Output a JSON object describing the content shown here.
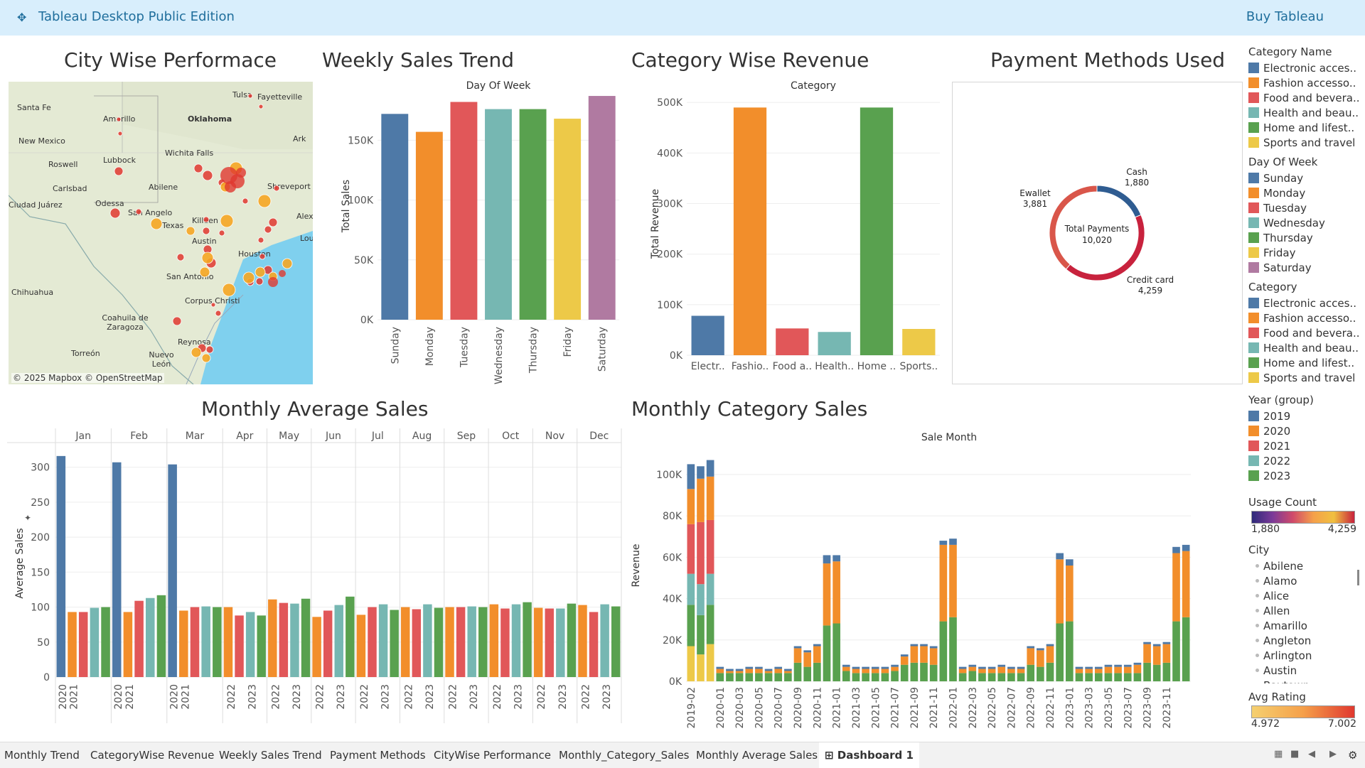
{
  "app": {
    "logo_icon": "tableau-logo-icon",
    "title": "Tableau Desktop Public Edition",
    "buy_label": "Buy Tableau"
  },
  "titles": {
    "city": "City Wise Performace",
    "weekly": "Weekly Sales Trend",
    "category": "Category Wise Revenue",
    "payment": "Payment Methods Used",
    "monthly_avg": "Monthly Average Sales",
    "monthly_cat": "Monthly Category Sales"
  },
  "map": {
    "copyright": "© 2025 Mapbox © OpenStreetMap",
    "labels": [
      "Santa Fe",
      "Tulsa",
      "Fayetteville",
      "Amarillo",
      "Oklahoma",
      "New Mexico",
      "Lubbock",
      "Wichita Falls",
      "Ark",
      "Roswell",
      "Abilene",
      "Shreveport",
      "Carlsbad",
      "Odessa",
      "San Angelo",
      "Killeen",
      "Alex",
      "Texas",
      "Ciudad Juárez",
      "Austin",
      "Lou",
      "Houston",
      "San Antonio",
      "Chihuahua",
      "Corpus Christi",
      "Coahuila de Zaragoza",
      "Torreón",
      "Nuevo León",
      "Reynosa"
    ]
  },
  "chart_data": [
    {
      "id": "weekly",
      "type": "bar",
      "title": "Day Of Week",
      "ylabel": "Total Sales",
      "ylim": [
        0,
        190000
      ],
      "yticks": [
        "0K",
        "50K",
        "100K",
        "150K"
      ],
      "categories": [
        "Sunday",
        "Monday",
        "Tuesday",
        "Wednesday",
        "Thursday",
        "Friday",
        "Saturday"
      ],
      "values": [
        172000,
        157000,
        182000,
        176000,
        176000,
        168000,
        187000
      ],
      "colors": [
        "#4e79a7",
        "#f28e2b",
        "#e15759",
        "#76b7b2",
        "#59a14f",
        "#edc948",
        "#b07aa1"
      ]
    },
    {
      "id": "category",
      "type": "bar",
      "title": "Category",
      "ylabel": "Total Revenue",
      "ylim": [
        0,
        520000
      ],
      "yticks": [
        "0K",
        "100K",
        "200K",
        "300K",
        "400K",
        "500K"
      ],
      "categories": [
        "Electr..",
        "Fashio..",
        "Food a..",
        "Health..",
        "Home ..",
        "Sports.."
      ],
      "values": [
        78000,
        490000,
        53000,
        46000,
        490000,
        52000
      ],
      "colors": [
        "#4e79a7",
        "#f28e2b",
        "#e15759",
        "#76b7b2",
        "#59a14f",
        "#edc948"
      ]
    },
    {
      "id": "payment",
      "type": "pie",
      "center_label": "Total Payments",
      "total": "10,020",
      "slices": [
        {
          "name": "Cash",
          "value": 1880,
          "label": "1,880",
          "color": "#2f5c91"
        },
        {
          "name": "Credit card",
          "value": 4259,
          "label": "4,259",
          "color": "#c8223d"
        },
        {
          "name": "Ewallet",
          "value": 3881,
          "label": "3,881",
          "color": "#d9564a"
        }
      ]
    },
    {
      "id": "monthly_avg",
      "type": "bar",
      "ylabel": "Average Sales",
      "ylim": [
        0,
        325
      ],
      "yticks": [
        "0",
        "50",
        "100",
        "150",
        "200",
        "250",
        "300"
      ],
      "months": [
        {
          "name": "Jan",
          "bars": [
            {
              "year": "2019",
              "value": 316
            },
            {
              "year": "2020",
              "value": 93
            },
            {
              "year": "2021",
              "value": 93
            },
            {
              "year": "2022",
              "value": 99
            },
            {
              "year": "2023",
              "value": 100
            }
          ],
          "xlabels": [
            "2020",
            "2021"
          ]
        },
        {
          "name": "Feb",
          "bars": [
            {
              "year": "2019",
              "value": 307
            },
            {
              "year": "2020",
              "value": 93
            },
            {
              "year": "2021",
              "value": 109
            },
            {
              "year": "2022",
              "value": 113
            },
            {
              "year": "2023",
              "value": 117
            }
          ],
          "xlabels": [
            "2020",
            "2021"
          ]
        },
        {
          "name": "Mar",
          "bars": [
            {
              "year": "2019",
              "value": 304
            },
            {
              "year": "2020",
              "value": 95
            },
            {
              "year": "2021",
              "value": 100
            },
            {
              "year": "2022",
              "value": 101
            },
            {
              "year": "2023",
              "value": 100
            }
          ],
          "xlabels": [
            "2020",
            "2021"
          ]
        },
        {
          "name": "Apr",
          "bars": [
            {
              "year": "2020",
              "value": 100
            },
            {
              "year": "2021",
              "value": 88
            },
            {
              "year": "2022",
              "value": 93
            },
            {
              "year": "2023",
              "value": 88
            }
          ],
          "xlabels": [
            "2022",
            "2023"
          ]
        },
        {
          "name": "May",
          "bars": [
            {
              "year": "2020",
              "value": 111
            },
            {
              "year": "2021",
              "value": 106
            },
            {
              "year": "2022",
              "value": 105
            },
            {
              "year": "2023",
              "value": 112
            }
          ],
          "xlabels": [
            "2022",
            "2023"
          ]
        },
        {
          "name": "Jun",
          "bars": [
            {
              "year": "2020",
              "value": 86
            },
            {
              "year": "2021",
              "value": 95
            },
            {
              "year": "2022",
              "value": 103
            },
            {
              "year": "2023",
              "value": 115
            }
          ],
          "xlabels": [
            "2022",
            "2023"
          ]
        },
        {
          "name": "Jul",
          "bars": [
            {
              "year": "2020",
              "value": 89
            },
            {
              "year": "2021",
              "value": 100
            },
            {
              "year": "2022",
              "value": 104
            },
            {
              "year": "2023",
              "value": 96
            }
          ],
          "xlabels": [
            "2022",
            "2023"
          ]
        },
        {
          "name": "Aug",
          "bars": [
            {
              "year": "2020",
              "value": 100
            },
            {
              "year": "2021",
              "value": 97
            },
            {
              "year": "2022",
              "value": 104
            },
            {
              "year": "2023",
              "value": 99
            }
          ],
          "xlabels": [
            "2022",
            "2023"
          ]
        },
        {
          "name": "Sep",
          "bars": [
            {
              "year": "2020",
              "value": 100
            },
            {
              "year": "2021",
              "value": 100
            },
            {
              "year": "2022",
              "value": 101
            },
            {
              "year": "2023",
              "value": 100
            }
          ],
          "xlabels": [
            "2022",
            "2023"
          ]
        },
        {
          "name": "Oct",
          "bars": [
            {
              "year": "2020",
              "value": 104
            },
            {
              "year": "2021",
              "value": 98
            },
            {
              "year": "2022",
              "value": 104
            },
            {
              "year": "2023",
              "value": 107
            }
          ],
          "xlabels": [
            "2022",
            "2023"
          ]
        },
        {
          "name": "Nov",
          "bars": [
            {
              "year": "2020",
              "value": 99
            },
            {
              "year": "2021",
              "value": 98
            },
            {
              "year": "2022",
              "value": 98
            },
            {
              "year": "2023",
              "value": 105
            }
          ],
          "xlabels": [
            "2022",
            "2023"
          ]
        },
        {
          "name": "Dec",
          "bars": [
            {
              "year": "2020",
              "value": 103
            },
            {
              "year": "2021",
              "value": 93
            },
            {
              "year": "2022",
              "value": 104
            },
            {
              "year": "2023",
              "value": 101
            }
          ],
          "xlabels": [
            "2022",
            "2023"
          ]
        }
      ]
    },
    {
      "id": "monthly_cat",
      "type": "bar",
      "title": "Sale Month",
      "ylabel": "Revenue",
      "ylim": [
        0,
        112000
      ],
      "yticks": [
        "0K",
        "20K",
        "40K",
        "60K",
        "80K",
        "100K"
      ],
      "series_colors": [
        "#4e79a7",
        "#f28e2b",
        "#e15759",
        "#76b7b2",
        "#59a14f",
        "#edc948"
      ],
      "xtick_labels": [
        "2019-02",
        "2020-01",
        "2020-03",
        "2020-05",
        "2020-07",
        "2020-09",
        "2020-11",
        "2021-01",
        "2021-03",
        "2021-05",
        "2021-07",
        "2021-09",
        "2021-11",
        "2022-01",
        "2022-03",
        "2022-05",
        "2022-07",
        "2022-09",
        "2022-11",
        "2023-01",
        "2023-03",
        "2023-05",
        "2023-07",
        "2023-09",
        "2023-11"
      ],
      "bars": [
        [
          12000,
          17000,
          24000,
          15000,
          20000,
          17000
        ],
        [
          6000,
          21000,
          30000,
          15000,
          19000,
          13000
        ],
        [
          8000,
          21000,
          26000,
          15000,
          19000,
          18000
        ],
        [
          1000,
          2000,
          0,
          0,
          4000,
          0
        ],
        [
          1000,
          1000,
          0,
          0,
          4000,
          0
        ],
        [
          1000,
          1000,
          0,
          0,
          4000,
          0
        ],
        [
          1000,
          2000,
          0,
          0,
          4000,
          0
        ],
        [
          1000,
          2000,
          0,
          0,
          4000,
          0
        ],
        [
          1000,
          1000,
          0,
          0,
          4000,
          0
        ],
        [
          1000,
          2000,
          0,
          0,
          4000,
          0
        ],
        [
          1000,
          1000,
          0,
          0,
          4000,
          0
        ],
        [
          1000,
          7000,
          0,
          0,
          9000,
          0
        ],
        [
          1000,
          7000,
          0,
          0,
          7000,
          0
        ],
        [
          1000,
          8000,
          0,
          0,
          9000,
          0
        ],
        [
          4000,
          30000,
          0,
          0,
          27000,
          0
        ],
        [
          3000,
          30000,
          0,
          0,
          28000,
          0
        ],
        [
          1000,
          2000,
          0,
          0,
          5000,
          0
        ],
        [
          1000,
          2000,
          0,
          0,
          4000,
          0
        ],
        [
          1000,
          2000,
          0,
          0,
          4000,
          0
        ],
        [
          1000,
          2000,
          0,
          0,
          4000,
          0
        ],
        [
          1000,
          2000,
          0,
          0,
          4000,
          0
        ],
        [
          1000,
          2000,
          0,
          0,
          5000,
          0
        ],
        [
          1000,
          4000,
          0,
          0,
          8000,
          0
        ],
        [
          1000,
          8000,
          0,
          0,
          9000,
          0
        ],
        [
          1000,
          8000,
          0,
          0,
          9000,
          0
        ],
        [
          1000,
          8000,
          0,
          0,
          8000,
          0
        ],
        [
          2000,
          37000,
          0,
          0,
          29000,
          0
        ],
        [
          3000,
          35000,
          0,
          0,
          31000,
          0
        ],
        [
          1000,
          2000,
          0,
          0,
          4000,
          0
        ],
        [
          1000,
          2000,
          0,
          0,
          5000,
          0
        ],
        [
          1000,
          2000,
          0,
          0,
          4000,
          0
        ],
        [
          1000,
          2000,
          0,
          0,
          4000,
          0
        ],
        [
          1000,
          3000,
          0,
          0,
          4000,
          0
        ],
        [
          1000,
          2000,
          0,
          0,
          4000,
          0
        ],
        [
          1000,
          2000,
          0,
          0,
          4000,
          0
        ],
        [
          1000,
          8000,
          0,
          0,
          8000,
          0
        ],
        [
          1000,
          8000,
          0,
          0,
          7000,
          0
        ],
        [
          1000,
          8000,
          0,
          0,
          9000,
          0
        ],
        [
          3000,
          31000,
          0,
          0,
          28000,
          0
        ],
        [
          3000,
          27000,
          0,
          0,
          29000,
          0
        ],
        [
          1000,
          2000,
          0,
          0,
          4000,
          0
        ],
        [
          1000,
          2000,
          0,
          0,
          4000,
          0
        ],
        [
          1000,
          2000,
          0,
          0,
          4000,
          0
        ],
        [
          1000,
          3000,
          0,
          0,
          4000,
          0
        ],
        [
          1000,
          3000,
          0,
          0,
          4000,
          0
        ],
        [
          1000,
          3000,
          0,
          0,
          4000,
          0
        ],
        [
          1000,
          4000,
          0,
          0,
          4000,
          0
        ],
        [
          1000,
          9000,
          0,
          0,
          9000,
          0
        ],
        [
          1000,
          9000,
          0,
          0,
          8000,
          0
        ],
        [
          1000,
          9000,
          0,
          0,
          9000,
          0
        ],
        [
          3000,
          33000,
          0,
          0,
          29000,
          0
        ],
        [
          3000,
          32000,
          0,
          0,
          31000,
          0
        ]
      ]
    }
  ],
  "legends": {
    "category_name": {
      "title": "Category Name",
      "items": [
        {
          "label": "Electronic acces..",
          "color": "#4e79a7"
        },
        {
          "label": "Fashion accesso..",
          "color": "#f28e2b"
        },
        {
          "label": "Food and bevera..",
          "color": "#e15759"
        },
        {
          "label": "Health and beau..",
          "color": "#76b7b2"
        },
        {
          "label": "Home and lifest..",
          "color": "#59a14f"
        },
        {
          "label": "Sports and travel",
          "color": "#edc948"
        }
      ]
    },
    "day_of_week": {
      "title": "Day Of Week",
      "items": [
        {
          "label": "Sunday",
          "color": "#4e79a7"
        },
        {
          "label": "Monday",
          "color": "#f28e2b"
        },
        {
          "label": "Tuesday",
          "color": "#e15759"
        },
        {
          "label": "Wednesday",
          "color": "#76b7b2"
        },
        {
          "label": "Thursday",
          "color": "#59a14f"
        },
        {
          "label": "Friday",
          "color": "#edc948"
        },
        {
          "label": "Saturday",
          "color": "#b07aa1"
        }
      ]
    },
    "category": {
      "title": "Category",
      "items": [
        {
          "label": "Electronic acces..",
          "color": "#4e79a7"
        },
        {
          "label": "Fashion accesso..",
          "color": "#f28e2b"
        },
        {
          "label": "Food and bevera..",
          "color": "#e15759"
        },
        {
          "label": "Health and beau..",
          "color": "#76b7b2"
        },
        {
          "label": "Home and lifest..",
          "color": "#59a14f"
        },
        {
          "label": "Sports and travel",
          "color": "#edc948"
        }
      ]
    },
    "year_group": {
      "title": "Year (group)",
      "items": [
        {
          "label": "2019",
          "color": "#4e79a7"
        },
        {
          "label": "2020",
          "color": "#f28e2b"
        },
        {
          "label": "2021",
          "color": "#e15759"
        },
        {
          "label": "2022",
          "color": "#76b7b2"
        },
        {
          "label": "2023",
          "color": "#59a14f"
        }
      ]
    },
    "usage_count": {
      "title": "Usage Count",
      "min": "1,880",
      "max": "4,259"
    },
    "city": {
      "title": "City",
      "items": [
        "Abilene",
        "Alamo",
        "Alice",
        "Allen",
        "Amarillo",
        "Angleton",
        "Arlington",
        "Austin",
        "Baytown"
      ]
    },
    "avg_rating": {
      "title": "Avg Rating",
      "min": "4.972",
      "max": "7.002"
    }
  },
  "tabs": [
    {
      "label": "Monthly Trend"
    },
    {
      "label": "CategoryWise Revenue"
    },
    {
      "label": "Weekly Sales Trend"
    },
    {
      "label": "Payment Methods"
    },
    {
      "label": "CityWise Performance"
    },
    {
      "label": "Monthly_Category_Sales"
    },
    {
      "label": "Monthly Average Sales"
    },
    {
      "label": "Dashboard 1",
      "active": true
    }
  ]
}
